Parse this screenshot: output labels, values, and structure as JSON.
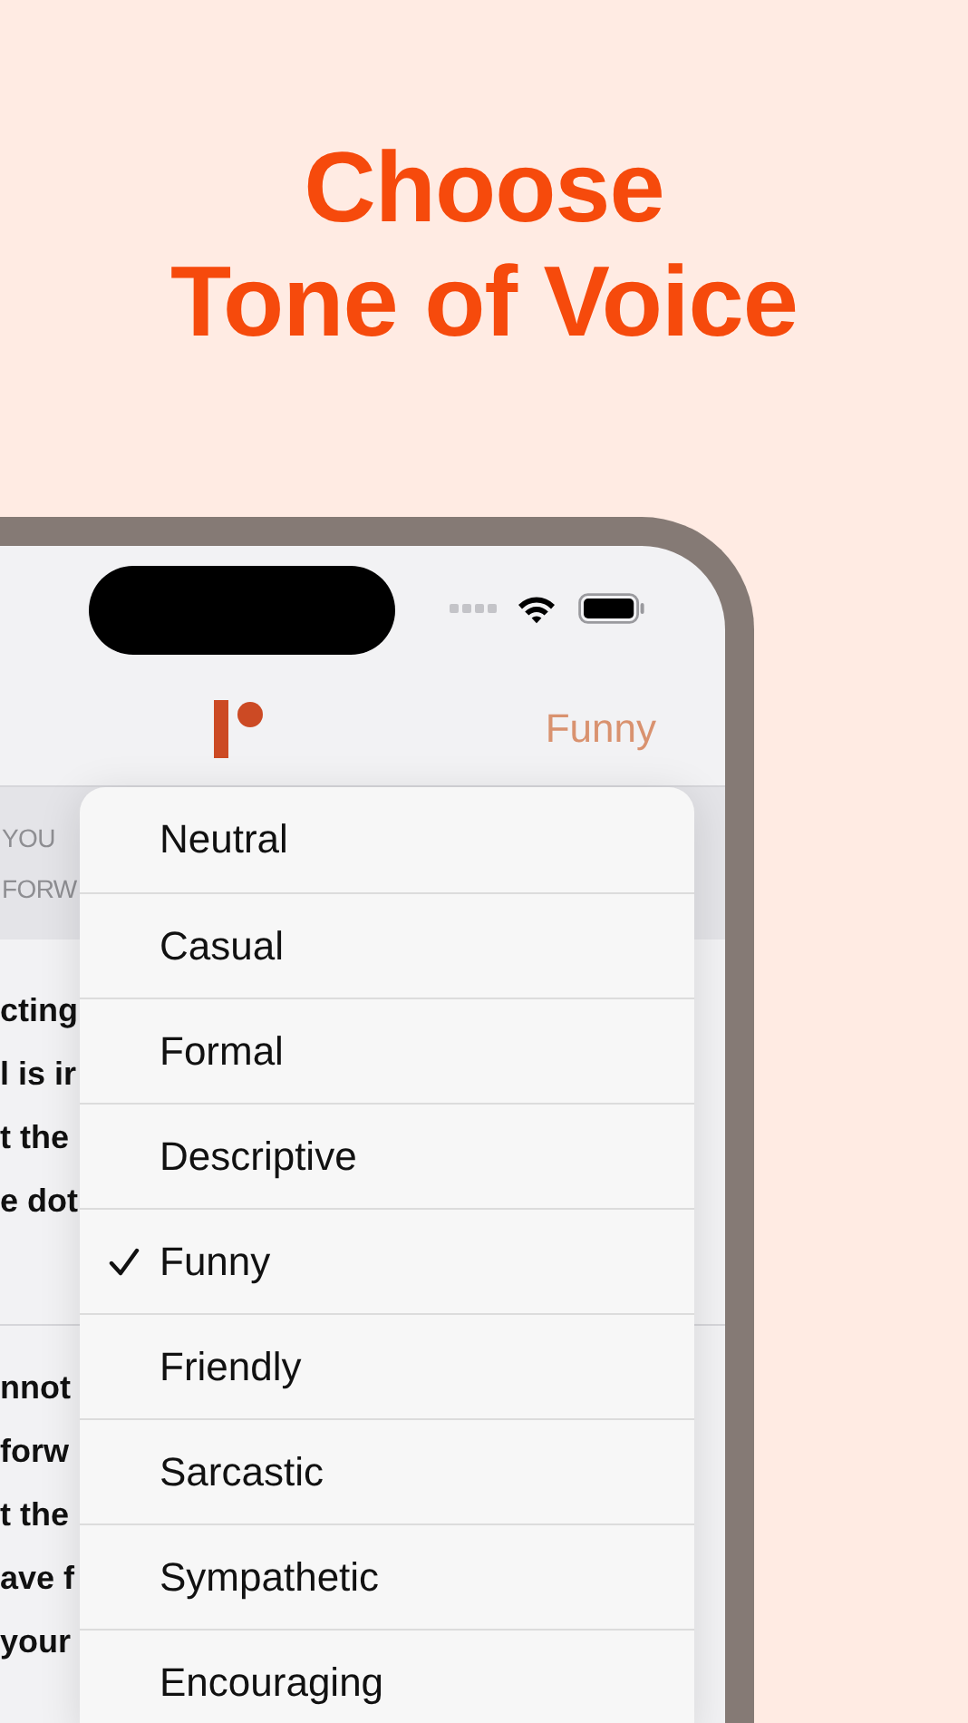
{
  "headline_lines": [
    "Choose",
    "Tone of Voice"
  ],
  "nav": {
    "tone_button": "Funny"
  },
  "header_fragments": [
    "YOU",
    "FORW"
  ],
  "paragraphs": [
    [
      "cting",
      "l is ir",
      "t the",
      "e dot"
    ],
    [
      "nnot",
      "forw",
      "t the",
      "ave f",
      "your"
    ]
  ],
  "tone_menu": [
    {
      "label": "Neutral",
      "selected": false
    },
    {
      "label": "Casual",
      "selected": false
    },
    {
      "label": "Formal",
      "selected": false
    },
    {
      "label": "Descriptive",
      "selected": false
    },
    {
      "label": "Funny",
      "selected": true
    },
    {
      "label": "Friendly",
      "selected": false
    },
    {
      "label": "Sarcastic",
      "selected": false
    },
    {
      "label": "Sympathetic",
      "selected": false
    },
    {
      "label": "Encouraging",
      "selected": false
    }
  ]
}
